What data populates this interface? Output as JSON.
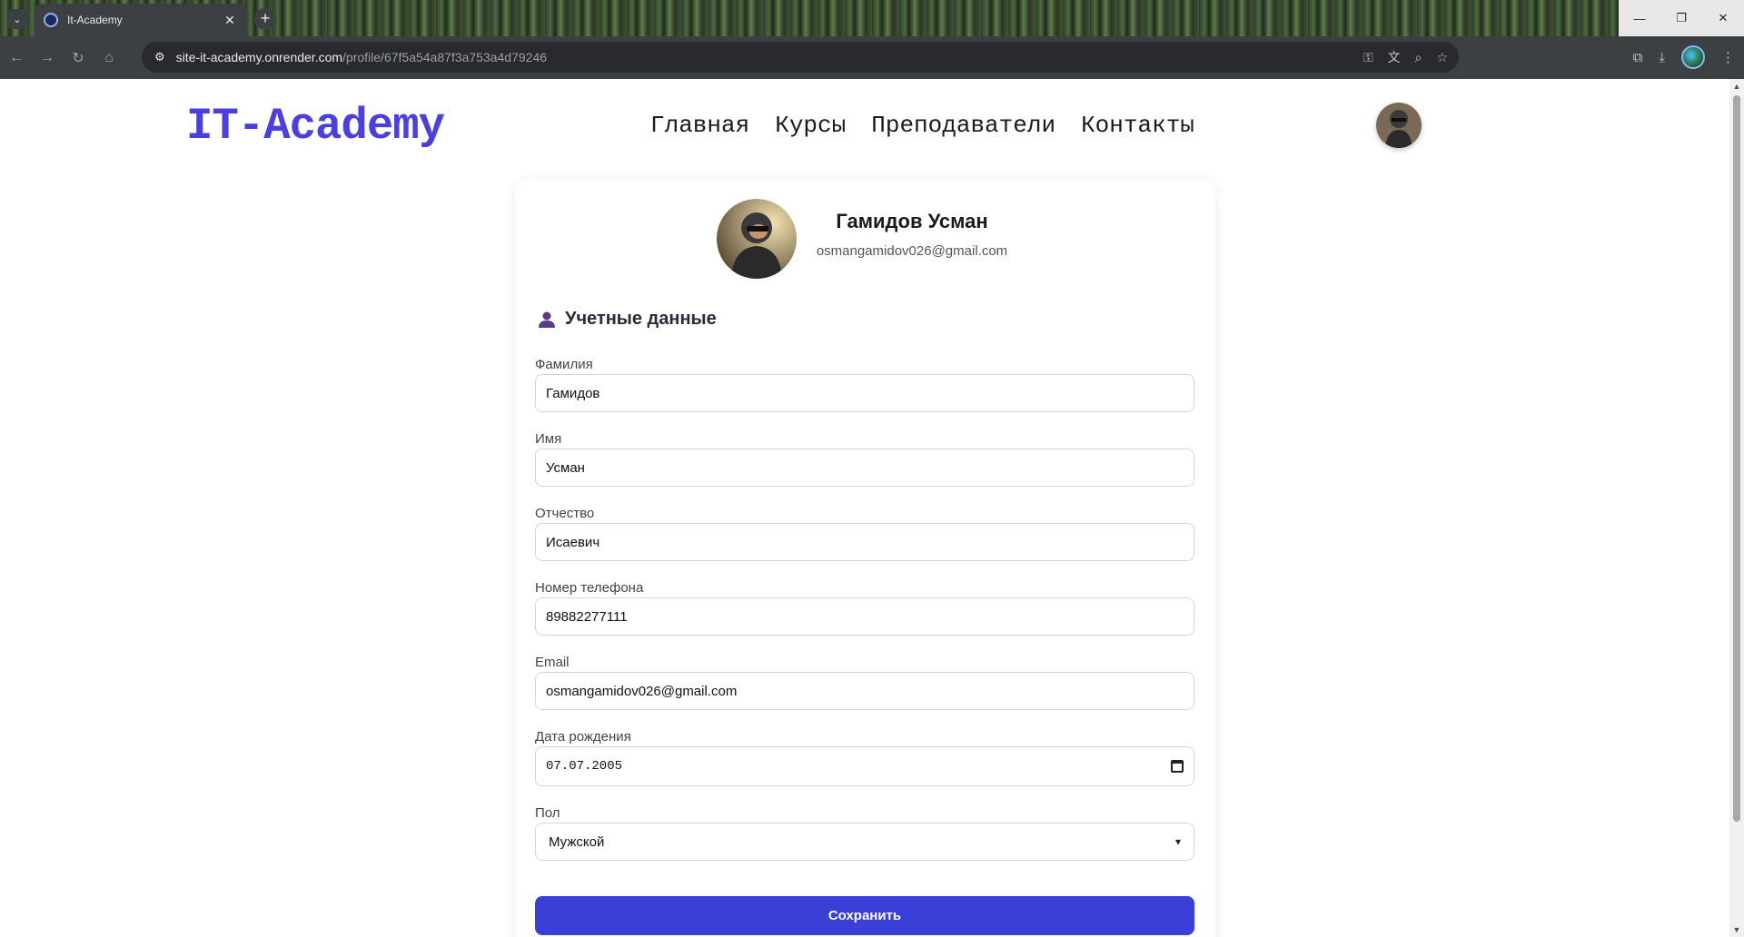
{
  "browser": {
    "tab_title": "It-Academy",
    "tab_close": "✕",
    "new_tab": "+",
    "url_host": "site-it-academy.onrender.com",
    "url_path": "/profile/67f5a54a87f3a753a4d79246"
  },
  "site": {
    "logo": "IT-Academy",
    "nav": [
      "Главная",
      "Курсы",
      "Преподаватели",
      "Контакты"
    ]
  },
  "profile": {
    "name": "Гамидов Усман",
    "email": "osmangamidov026@gmail.com"
  },
  "section": {
    "title": "Учетные данные",
    "icon": "user-icon"
  },
  "form": {
    "fields": [
      {
        "label": "Фамилия",
        "value": "Гамидов"
      },
      {
        "label": "Имя",
        "value": "Усман"
      },
      {
        "label": "Отчество",
        "value": "Исаевич"
      },
      {
        "label": "Номер телефона",
        "value": "89882277111"
      },
      {
        "label": "Email",
        "value": "osmangamidov026@gmail.com"
      },
      {
        "label": "Дата рождения",
        "value": "07.07.2005"
      },
      {
        "label": "Пол",
        "value": "Мужской"
      }
    ],
    "save_label": "Сохранить"
  },
  "colors": {
    "brand": "#4a3fe0",
    "button": "#3a3fd8"
  }
}
